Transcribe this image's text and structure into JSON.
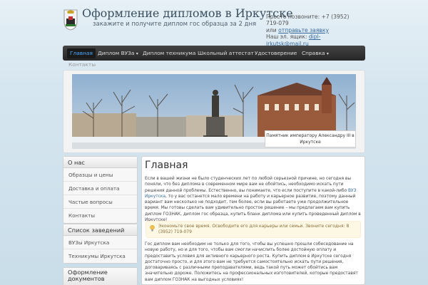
{
  "header": {
    "site_title": "Оформление дипломов в Иркутске",
    "site_description": "закажите и получите диплом гос образца за 2 дня",
    "contact_line1": "Просто позвоните: +7 (3952) 719-079",
    "contact_or": "или",
    "contact_order_link": "отправьте заявку",
    "contact_email_label": "Наш эл. ящик:",
    "contact_email": "dipl-irkutsk@mail.ru"
  },
  "nav": {
    "items": [
      {
        "label": "Главная",
        "active": true
      },
      {
        "label": "Диплом ВУЗа",
        "dropdown": true
      },
      {
        "label": "Диплом техникума"
      },
      {
        "label": "Школьный аттестат"
      },
      {
        "label": "Удостоверение"
      },
      {
        "label": "Справка",
        "dropdown": true
      }
    ],
    "second_row": "Контакты",
    "caret": "▾"
  },
  "banner": {
    "caption_line1": "Памятник императору Александру III в",
    "caption_line2": "Иркутске"
  },
  "sidebar": {
    "box1": {
      "title": "О нас",
      "items": [
        "Образцы и цены",
        "Доставка и оплата",
        "Частые вопросы",
        "Контакты"
      ]
    },
    "box2": {
      "title": "Список заведений",
      "items": [
        "ВУЗы Иркутска",
        "Техникумы Иркутска"
      ]
    },
    "box3": {
      "title_line1": "Оформление",
      "title_line2": "документов"
    }
  },
  "main": {
    "title": "Главная",
    "p1_before": "Если в вашей жизни не было студенческих лет по любой серьезной причине, но сегодня вы поняли, что без диплома в современном мире вам не обойтись, необходимо искать пути решения данной проблемы. Естественно, вы понимаете, что если поступите в какой-либо",
    "p1_link": "ВУЗ Иркутска",
    "p1_after": ", то у вас останется мало времени на работу и карьерное развитие, поэтому данный вариант вам несколько не подходит, тем более, если вы работаете уже продолжительное время. Мы готовы сделать вам удивительно простое решение – мы предлагаем вам купить диплом ГОЗНАК, диплом гос образца, купить бланк диплома или купить проведенный диплом в Иркутске!",
    "alert": "Экономьте свое время. Освободите его для карьеры или семьи. Звоните сегодня: 8 (3952) 719-079",
    "p2": "Гос диплом вам необходим не только для того, чтобы вы успешно прошли собеседование на новую работу, но и для того, чтобы вам смогли начислить более достойную оплату и предоставить условия для активного карьерного роста. Купить диплом в Иркутске сегодня достаточно просто, и для этого вам не требуется самостоятельно искать пути решения, договариваясь с различными преподавателями, ведь такой путь может обойтись вам значительно дороже. Положитесь на профессиональных изготовителей, которые предоставят вам диплом ГОЗНАК на выгодных условиях!"
  },
  "colors": {
    "nav_bg": "#2f2f2f",
    "nav_active_text": "#4aa9ff",
    "link": "#35679b",
    "alert_bg": "#fcf8e3"
  }
}
